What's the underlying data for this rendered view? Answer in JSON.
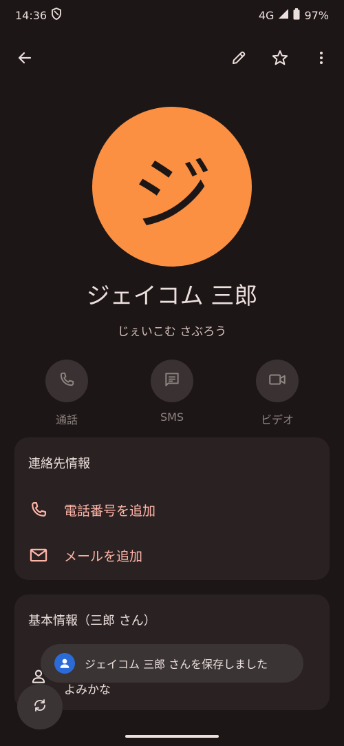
{
  "status_bar": {
    "time": "14:36",
    "network": "4G",
    "battery": "97%",
    "shield_icon": "shield-icon",
    "signal_icon": "signal-icon",
    "battery_icon": "battery-icon"
  },
  "top_bar": {
    "back_icon": "arrow-left-icon",
    "edit_icon": "pencil-icon",
    "favorite_icon": "star-outline-icon",
    "more_icon": "more-vert-icon"
  },
  "contact": {
    "avatar_letter": "ジ",
    "avatar_color": "#fb8f42",
    "name": "ジェイコム 三郎",
    "reading": "じぇいこむ さぶろう"
  },
  "actions": [
    {
      "label": "通話",
      "icon": "phone-icon"
    },
    {
      "label": "SMS",
      "icon": "message-icon"
    },
    {
      "label": "ビデオ",
      "icon": "video-icon"
    }
  ],
  "contact_info": {
    "title": "連絡先情報",
    "rows": [
      {
        "label": "電話番号を追加",
        "icon": "phone-icon"
      },
      {
        "label": "メールを追加",
        "icon": "mail-icon"
      }
    ]
  },
  "basic_info": {
    "title": "基本情報（三郎 さん）",
    "row_label": "よみかな",
    "row_icon": "person-icon"
  },
  "snackbar": {
    "text": "ジェイコム 三郎 さんを保存しました",
    "icon": "account-icon"
  },
  "fab": {
    "icon": "sync-icon"
  },
  "colors": {
    "background": "#1c1616",
    "card": "#2a2222",
    "accent_text": "#ffb4a7",
    "avatar": "#fb8f42"
  }
}
